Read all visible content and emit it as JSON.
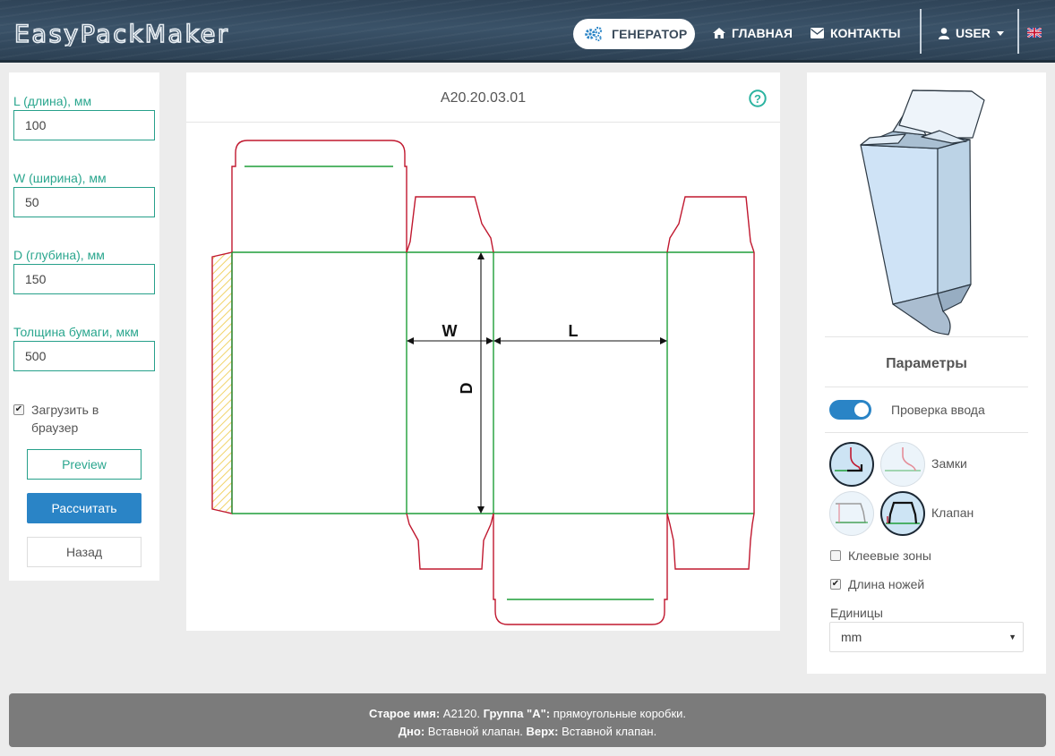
{
  "header": {
    "brand": "EasyPackMaker",
    "generator_label": "ГЕНЕРАТОР",
    "home_label": "ГЛАВНАЯ",
    "contacts_label": "КОНТАКТЫ",
    "user_label": "USER",
    "accent": "#2a84c6"
  },
  "form": {
    "length_label": "L (длина), мм",
    "length_value": "100",
    "width_label": "W (ширина), мм",
    "width_value": "50",
    "depth_label": "D (глубина), мм",
    "depth_value": "150",
    "thickness_label": "Толщина бумаги, мкм",
    "thickness_value": "500",
    "download_label": "Загрузить в браузер",
    "download_checked": true,
    "preview_label": "Preview",
    "calculate_label": "Рассчитать",
    "back_label": "Назад"
  },
  "drawing": {
    "code": "A20.20.03.01",
    "dim_w": "W",
    "dim_l": "L",
    "dim_d": "D",
    "cut_color": "#c0182f",
    "crease_color": "#1e9e38"
  },
  "params": {
    "title": "Параметры",
    "input_check_label": "Проверка ввода",
    "input_check_on": true,
    "locks_label": "Замки",
    "flap_label": "Клапан",
    "glue_zones_label": "Клеевые зоны",
    "glue_zones_checked": false,
    "knife_length_label": "Длина ножей",
    "knife_length_checked": true,
    "units_label": "Единицы",
    "units_value": "mm"
  },
  "footer": {
    "old_name_label": "Старое имя:",
    "old_name_value": " A2120.",
    "group_label": "Группа \"A\":",
    "group_value": " прямоугольные коробки.",
    "bottom_label": "Дно:",
    "bottom_value": " Вставной клапан.",
    "top_label": "Верх:",
    "top_value": " Вставной клапан."
  }
}
